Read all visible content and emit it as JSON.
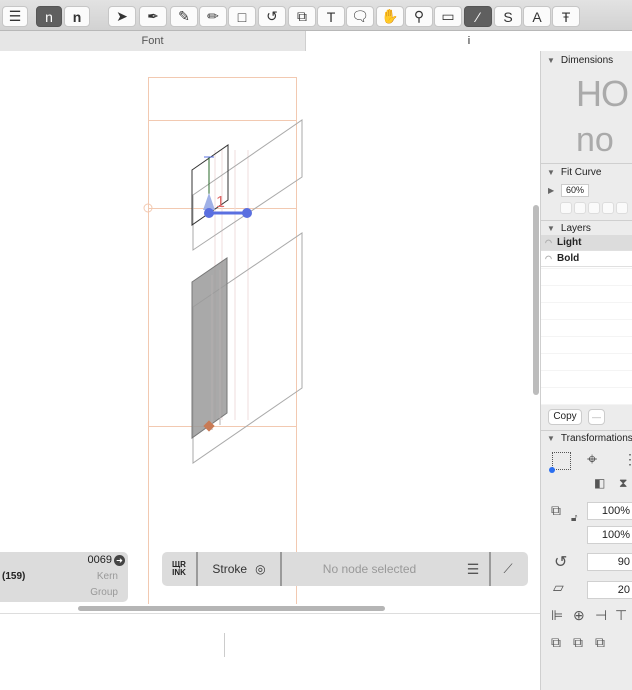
{
  "toolbar": {
    "tools": [
      {
        "name": "sidebar-toggle",
        "glyph": "☰"
      },
      {
        "name": "preview-light",
        "glyph": "n"
      },
      {
        "name": "preview-bold",
        "glyph": "n"
      },
      {
        "name": "select-tool",
        "glyph": "➤"
      },
      {
        "name": "select-all-layers-tool",
        "glyph": "✒"
      },
      {
        "name": "draw-tool",
        "glyph": "✎"
      },
      {
        "name": "pencil-tool",
        "glyph": "✏"
      },
      {
        "name": "primitives-tool",
        "glyph": "□"
      },
      {
        "name": "rotate-tool",
        "glyph": "↺"
      },
      {
        "name": "scale-tool",
        "glyph": "⧉"
      },
      {
        "name": "text-tool",
        "glyph": "T"
      },
      {
        "name": "annotation-tool",
        "glyph": "🗨"
      },
      {
        "name": "hand-tool",
        "glyph": "✋"
      },
      {
        "name": "zoom-tool",
        "glyph": "⚲"
      },
      {
        "name": "measurement-tool",
        "glyph": "▭"
      },
      {
        "name": "knife-tool",
        "glyph": "⁄"
      },
      {
        "name": "symbol-tool",
        "glyph": "S"
      },
      {
        "name": "anchor-tool",
        "glyph": "A"
      },
      {
        "name": "type-tool",
        "glyph": "Ŧ"
      }
    ]
  },
  "tabs": [
    {
      "label": "Font"
    },
    {
      "label": "i"
    }
  ],
  "right_panel": {
    "dimensions": {
      "title": "Dimensions",
      "sample_upper": "HO",
      "sample_lower": "no"
    },
    "fit_curve": {
      "title": "Fit Curve",
      "value": "60%"
    },
    "layers": {
      "title": "Layers",
      "items": [
        {
          "label": "Light"
        },
        {
          "label": "Bold"
        }
      ]
    },
    "copy_label": "Copy",
    "remove_label": "—",
    "transformations": {
      "title": "Transformations",
      "scale_x": "100%",
      "scale_y": "100%",
      "rotate": "90",
      "slant": "20"
    }
  },
  "glyph_info": {
    "unicode": "0069",
    "width": "(159)",
    "kern_label": "Kern",
    "group_label": "Group"
  },
  "bottom_toolbar": {
    "stroke_label": "Stroke",
    "status": "No node selected"
  },
  "colors": {
    "accent": "#5a6fe0",
    "metrics": "#f0c8b0",
    "node": "#c87a55"
  }
}
